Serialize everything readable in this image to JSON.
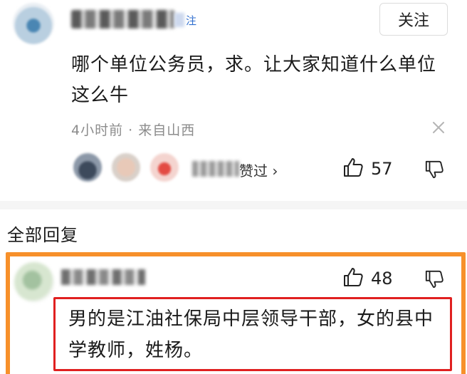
{
  "comment": {
    "author_badge": "注",
    "follow_label": "关注",
    "text": "哪个单位公务员，求。让大家知道什么单位这么牛",
    "meta": "4小时前 · 来自山西",
    "likers_text": "赞过 ›",
    "like_count": "57"
  },
  "replies_section": {
    "title": "全部回复"
  },
  "reply": {
    "like_count": "48",
    "text": "男的是江油社保局中层领导干部，女的县中学教师，姓杨。"
  },
  "colors": {
    "highlight_orange": "#f7902a",
    "highlight_red": "#e02020",
    "badge_blue": "#2f6ecf"
  }
}
